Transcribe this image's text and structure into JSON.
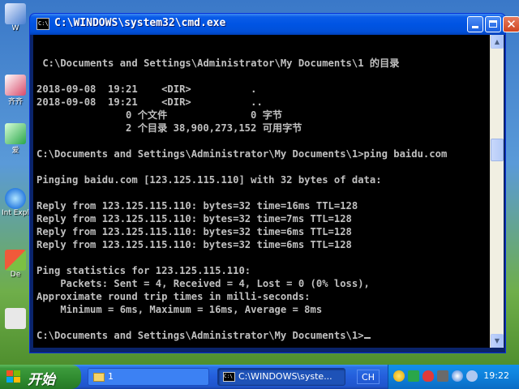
{
  "desktop": {
    "icons": [
      {
        "label": "W"
      },
      {
        "label": "齐齐"
      },
      {
        "label": "爱"
      },
      {
        "label": "Int Expl"
      },
      {
        "label": "De"
      }
    ]
  },
  "window": {
    "title": "C:\\WINDOWS\\system32\\cmd.exe",
    "icon_text": "C:\\",
    "console_lines": [
      " C:\\Documents and Settings\\Administrator\\My Documents\\1 的目录",
      "",
      "2018-09-08  19:21    <DIR>          .",
      "2018-09-08  19:21    <DIR>          ..",
      "               0 个文件              0 字节",
      "               2 个目录 38,900,273,152 可用字节",
      "",
      "C:\\Documents and Settings\\Administrator\\My Documents\\1>ping baidu.com",
      "",
      "Pinging baidu.com [123.125.115.110] with 32 bytes of data:",
      "",
      "Reply from 123.125.115.110: bytes=32 time=16ms TTL=128",
      "Reply from 123.125.115.110: bytes=32 time=7ms TTL=128",
      "Reply from 123.125.115.110: bytes=32 time=6ms TTL=128",
      "Reply from 123.125.115.110: bytes=32 time=6ms TTL=128",
      "",
      "Ping statistics for 123.125.115.110:",
      "    Packets: Sent = 4, Received = 4, Lost = 0 (0% loss),",
      "Approximate round trip times in milli-seconds:",
      "    Minimum = 6ms, Maximum = 16ms, Average = 8ms",
      "",
      "C:\\Documents and Settings\\Administrator\\My Documents\\1>"
    ],
    "console_text_color": "#c0c0c0",
    "console_bg_color": "#000000"
  },
  "taskbar": {
    "start_label": "开始",
    "tasks": [
      {
        "label": "1"
      },
      {
        "label": "C:\\WINDOWS\\syste..."
      }
    ],
    "language": "CH",
    "clock": "19:22"
  }
}
